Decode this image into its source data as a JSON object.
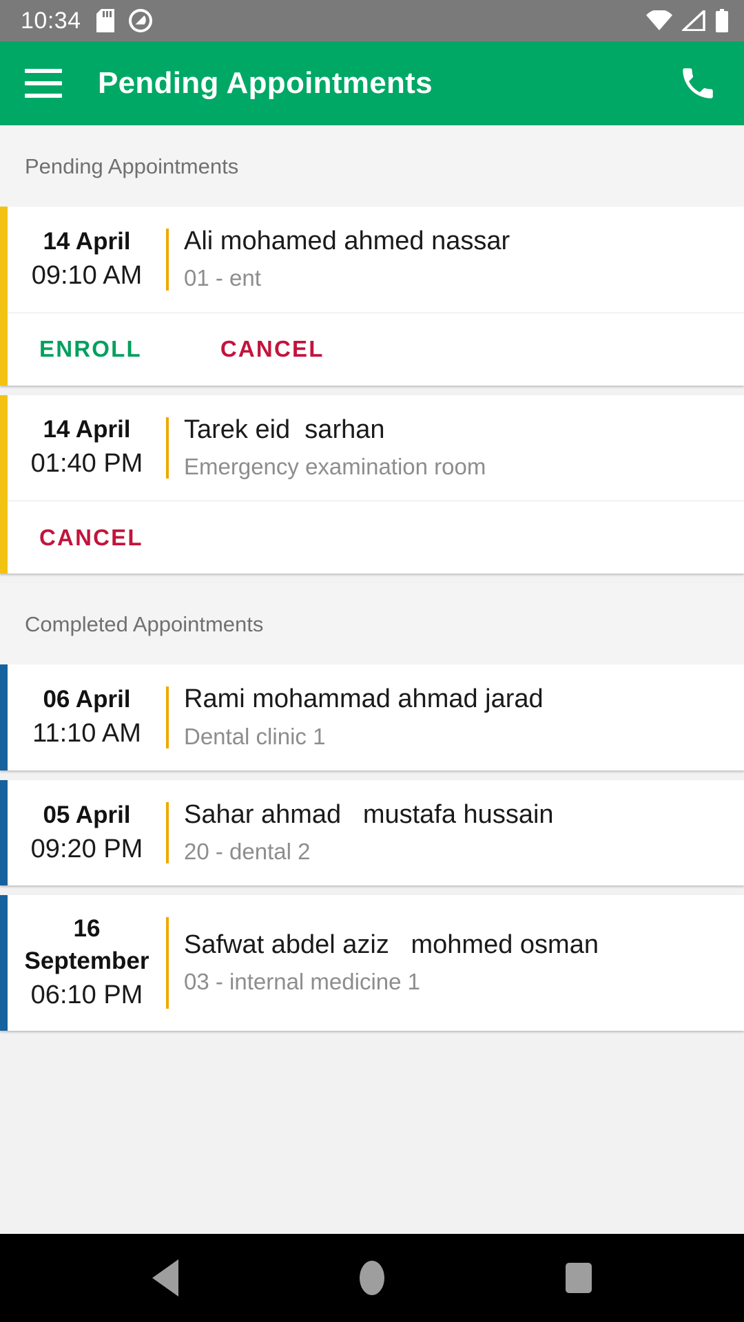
{
  "status_bar": {
    "clock": "10:34",
    "icons_left": [
      "sd-card-icon",
      "do-not-disturb-icon"
    ],
    "icons_right": [
      "wifi-icon",
      "cellular-signal-icon",
      "battery-icon"
    ],
    "background_color": "#7a7a7a"
  },
  "app_bar": {
    "title": "Pending Appointments",
    "menu_icon": "hamburger-menu-icon",
    "call_icon": "phone-call-icon",
    "background_color": "#00a865",
    "text_color": "#ffffff"
  },
  "sections": [
    {
      "header": "Pending Appointments",
      "accent_color": "#f2c313",
      "appointments": [
        {
          "date": "14 April",
          "time": "09:10 AM",
          "patient": "Ali mohamed ahmed nassar",
          "clinic": "01 - ent",
          "actions": [
            "ENROLL",
            "CANCEL"
          ]
        },
        {
          "date": "14 April",
          "time": "01:40 PM",
          "patient": "Tarek eid  sarhan",
          "clinic": "Emergency examination room",
          "actions": [
            "CANCEL"
          ]
        }
      ]
    },
    {
      "header": "Completed Appointments",
      "accent_color": "#15629f",
      "appointments": [
        {
          "date": "06 April",
          "time": "11:10 AM",
          "patient": "Rami mohammad ahmad jarad",
          "clinic": "Dental clinic 1",
          "actions": []
        },
        {
          "date": "05 April",
          "time": "09:20 PM",
          "patient": "Sahar ahmad   mustafa hussain",
          "clinic": "20 - dental 2",
          "actions": []
        },
        {
          "date": "16 September",
          "time": "06:10 PM",
          "patient": "Safwat abdel aziz   mohmed osman",
          "clinic": "03 - internal medicine 1",
          "actions": []
        }
      ]
    }
  ],
  "action_labels": {
    "enroll": "ENROLL",
    "cancel": "CANCEL"
  },
  "colors": {
    "primary_green": "#00a865",
    "enroll_green": "#00a05e",
    "cancel_red": "#c2143c",
    "pending_accent": "#f2c313",
    "completed_accent": "#15629f",
    "divider_orange": "#f0a800",
    "page_background": "#f2f2f2",
    "secondary_text": "#8d8d8d"
  },
  "nav_bar": {
    "buttons": [
      "back-icon",
      "home-icon",
      "recents-icon"
    ],
    "background_color": "#000000"
  }
}
